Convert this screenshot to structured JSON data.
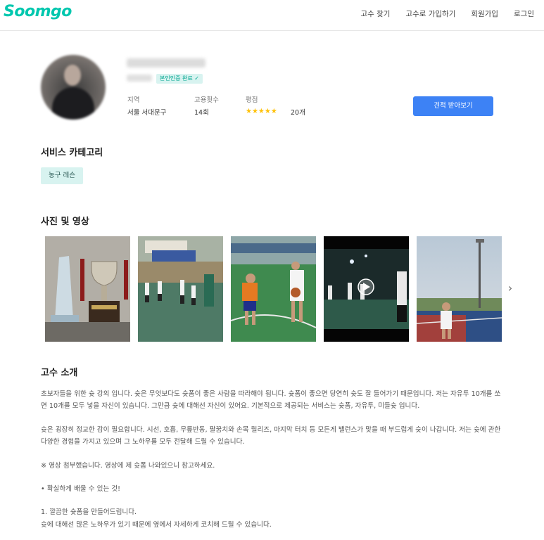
{
  "header": {
    "logo": "Soomgo",
    "nav": [
      "고수 찾기",
      "고수로 가입하기",
      "회원가입",
      "로그인"
    ]
  },
  "profile": {
    "verified_label": "본인인증 완료 ✓",
    "stats": [
      {
        "label": "지역",
        "value": "서울 서대문구"
      },
      {
        "label": "고용횟수",
        "value": "14회"
      },
      {
        "label": "평점",
        "value": "20개"
      }
    ],
    "rating_stars": 5,
    "stars_text": "★★★★★",
    "quote_button": "견적 받아보기"
  },
  "categories": {
    "title": "서비스 카테고리",
    "items": [
      "농구 레슨"
    ]
  },
  "photos": {
    "title": "사진 및 영상",
    "items": [
      {
        "icon": "trophy-photo"
      },
      {
        "icon": "court-group-photo"
      },
      {
        "icon": "dribble-photo"
      },
      {
        "icon": "night-video-photo",
        "is_video": true
      },
      {
        "icon": "outdoor-court-photo"
      }
    ],
    "next_icon": "chevron-right-icon",
    "next_glyph": "›"
  },
  "intro": {
    "title": "고수 소개",
    "paragraphs": [
      [
        "초보자들을 위한 슛 강의 입니다. 슛은 무엇보다도 슛폼이 좋은 사람을 따라해야 됩니다. 슛폼이 좋으면 당연히 슛도 잘 들어가기 때문입니다. 저는 자유투 10개를 쏘",
        "면 10개를 모두 넣을 자신이 있습니다. 그만큼 슛에 대해선 자신이 있어요. 기본적으로 제공되는 서비스는 슛폼, 자유투, 미들슛 입니다."
      ],
      [
        "슛은 굉장히 정교한 감이 필요합니다. 시선, 호흡, 무릎반동, 팔꿈치와 손목 릴리즈, 마지막 터치 등 모든게 밸런스가 맞을 때 부드럽게 슛이 나갑니다. 저는 슛에 관한",
        "다양한 경험을 가지고 있으며 그 노하우를 모두 전달해 드릴 수 있습니다."
      ],
      [
        "※ 영상 첨부했습니다. 영상에 제 슛폼 나와있으니 참고하세요."
      ],
      [
        "• 확실하게 배울 수 있는 것!"
      ],
      [
        "1. 깔끔한 슛폼을 만들어드립니다.",
        "슛에 대해선 많은 노하우가 있기 때문에 옆에서 자세하게 코치해 드릴 수 있습니다."
      ]
    ]
  }
}
